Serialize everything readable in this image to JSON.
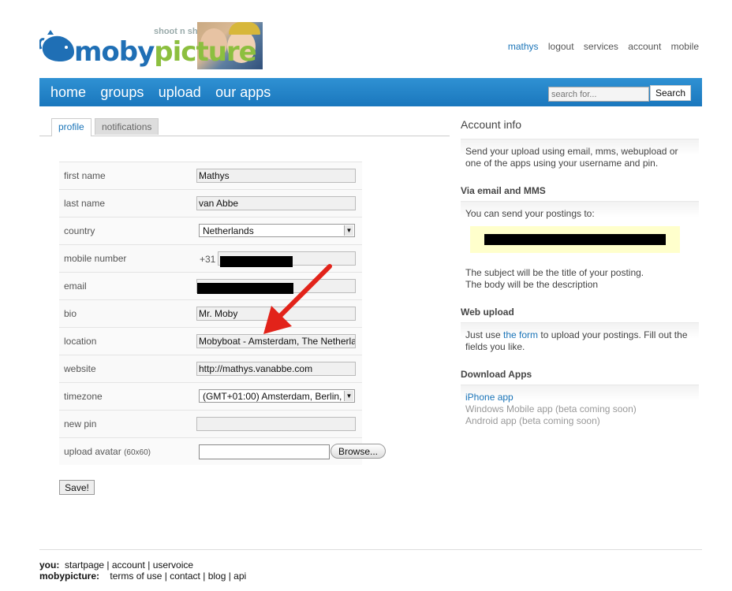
{
  "header": {
    "logo": {
      "text_blue": "moby",
      "text_green": "picture",
      "tagline": "shoot n sha"
    },
    "topnav": [
      "mathys",
      "logout",
      "services",
      "account",
      "mobile"
    ],
    "mainnav": [
      "home",
      "groups",
      "upload",
      "our apps"
    ],
    "search": {
      "placeholder": "search for...",
      "button": "Search"
    }
  },
  "tabs": [
    {
      "label": "profile",
      "active": true
    },
    {
      "label": "notifications",
      "active": false
    }
  ],
  "form": {
    "fields": [
      {
        "label": "first name",
        "value": "Mathys"
      },
      {
        "label": "last name",
        "value": "van Abbe"
      },
      {
        "label": "country",
        "value": "Netherlands",
        "type": "select"
      },
      {
        "label": "mobile number",
        "prefix": "+31",
        "value": ""
      },
      {
        "label": "email",
        "value": ""
      },
      {
        "label": "bio",
        "value": "Mr. Moby"
      },
      {
        "label": "location",
        "value": "Mobyboat - Amsterdam, The Netherla"
      },
      {
        "label": "website",
        "value": "http://mathys.vanabbe.com"
      },
      {
        "label": "timezone",
        "value": "(GMT+01:00) Amsterdam, Berlin,",
        "type": "select"
      },
      {
        "label": "new pin",
        "value": ""
      },
      {
        "label": "upload avatar",
        "label_small": "(60x60)",
        "button": "Browse..."
      }
    ],
    "save": "Save!"
  },
  "sidebar": {
    "title": "Account info",
    "intro": [
      "Send your upload using email, mms, webupload or",
      "one of the apps using your username and pin."
    ],
    "email": {
      "heading": "Via email and MMS",
      "text": "You can send your postings to:",
      "note": [
        "The subject will be the title of your posting.",
        "The body will be the description"
      ]
    },
    "web": {
      "heading": "Web upload",
      "text_before": "Just use ",
      "link": "the form",
      "text_after": " to upload your postings. Fill out the",
      "text_line2": "fields you like."
    },
    "apps": {
      "heading": "Download Apps",
      "items": [
        "iPhone app",
        "Windows Mobile app (beta coming soon)",
        "Android app (beta coming soon)"
      ]
    }
  },
  "footer": {
    "you_label": "you:",
    "you_links": [
      "startpage",
      "account",
      "uservoice"
    ],
    "moby_label": "mobypicture:",
    "moby_links": [
      "terms of use",
      "contact",
      "blog",
      "api"
    ]
  },
  "colors": {
    "brand_blue": "#1a77bd",
    "brand_green": "#8cbf3f",
    "annotation_arrow": "#e2231a"
  }
}
